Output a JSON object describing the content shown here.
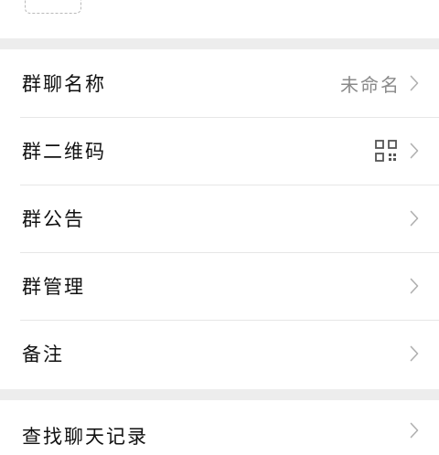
{
  "settings": {
    "group_name_label": "群聊名称",
    "group_name_value": "未命名",
    "group_qr_label": "群二维码",
    "group_notice_label": "群公告",
    "group_manage_label": "群管理",
    "remark_label": "备注",
    "search_history_label": "查找聊天记录"
  },
  "icons": {
    "qr": "qr-code-icon",
    "chevron": "chevron-right-icon",
    "add_member": "add-member-icon"
  },
  "colors": {
    "background": "#ededed",
    "card": "#ffffff",
    "text": "#111111",
    "secondary_text": "#8a8a8a",
    "chevron": "#b0b0b0"
  }
}
